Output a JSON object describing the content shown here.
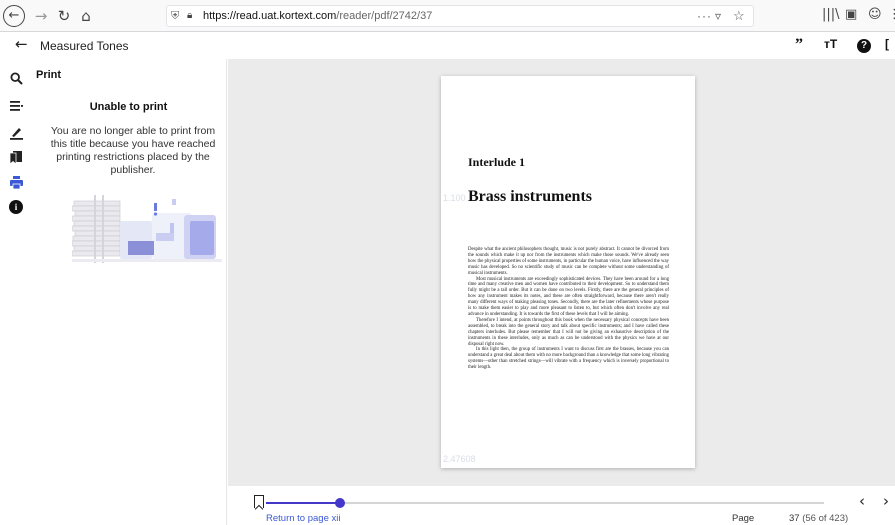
{
  "browser": {
    "back_icon": "←",
    "forward_icon": "→",
    "reload_icon": "↻",
    "home_icon": "⌂",
    "url_host": "https://read.uat.kortext.com",
    "url_path": "/reader/pdf/2742/37",
    "more_icon": "···",
    "pocket_icon": "▿",
    "star_icon": "☆",
    "library_icon": "|||\\",
    "sidebar_icon": "▣",
    "account_icon": "☺"
  },
  "app": {
    "back_icon": "←",
    "title": "Measured Tones",
    "quote_icon": "”",
    "text_size_icon": "тT",
    "help_icon": "?",
    "expand_icon": "["
  },
  "rail": {
    "search_icon": "⌕",
    "contents_icon": "≡",
    "highlight_icon": "✎",
    "bookmarks_icon": "■",
    "print_icon": "⎙",
    "info_icon": "i"
  },
  "panel": {
    "title": "Print",
    "heading": "Unable to print",
    "message": "You are no longer able to print from this title because you have reached printing restrictions placed by the publisher."
  },
  "book_page": {
    "interlude": "Interlude 1",
    "chapter_title": "Brass instruments",
    "ghost_a": "1.100",
    "ghost_b": "2.47608",
    "paragraphs": [
      "Despite what the ancient philosophers thought, music is not purely abstract. It cannot be divorced from the sounds which make it up nor from the instruments which make those sounds. We've already seen how the physical properties of some instruments, in particular the human voice, have influenced the way music has developed. So no scientific study of music can be complete without some understanding of musical instruments.",
      "Most musical instruments are exceedingly sophisticated devices. They have been around for a long time and many creative men and women have contributed to their development. So to understand them fully might be a tall order. But it can be done on two levels. Firstly, there are the general principles of how any instrument makes its notes, and these are often straightforward, because there aren't really many different ways of making pleasing tones. Secondly, there are the later refinements whose purpose is to make them easier to play and more pleasant to listen to, but which often don't involve any real advance in understanding. It is towards the first of these levels that I will be aiming.",
      "Therefore I intend, at points throughout this book when the necessary physical concepts have been assembled, to break into the general story and talk about specific instruments; and I have called these chapters interludes. But please remember that I will not be giving an exhaustive description of the instruments in these interludes, only as much as can be understood with the physics we have at our disposal right now.",
      "In this light then, the group of instruments I want to discuss first are the brasses, because you can understand a great deal about them with no more background than a knowledge that some long vibrating systems—other than stretched strings—will vibrate with a frequency which is inversely proportional to their length."
    ]
  },
  "footer": {
    "bookmark_icon": "bookmark-icon",
    "progress": 0.1325,
    "return_link": "Return to page xii",
    "page_label": "Page",
    "page_number": "37",
    "page_of": "(56 of 423)",
    "prev_icon": "‹",
    "next_icon": "›"
  }
}
